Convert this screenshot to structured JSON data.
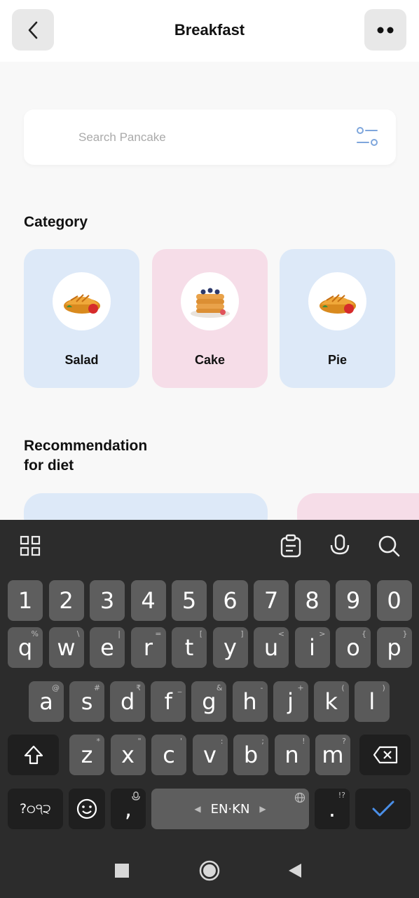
{
  "header": {
    "title": "Breakfast",
    "back_icon": "chevron-left-icon",
    "more_icon": "more-dots-icon"
  },
  "search": {
    "placeholder": "Search Pancake",
    "value": "",
    "filter_icon": "filter-icon"
  },
  "category": {
    "title": "Category",
    "items": [
      {
        "label": "Salad",
        "icon": "pie-icon",
        "color": "#dde9f8"
      },
      {
        "label": "Cake",
        "icon": "pancake-icon",
        "color": "#f6dde8"
      },
      {
        "label": "Pie",
        "icon": "pie-icon",
        "color": "#dde9f8"
      }
    ]
  },
  "recommendation": {
    "title_line1": "Recommendation",
    "title_line2": "for diet"
  },
  "keyboard": {
    "numbers": [
      "1",
      "2",
      "3",
      "4",
      "5",
      "6",
      "7",
      "8",
      "9",
      "0"
    ],
    "row1": [
      [
        "q",
        "%"
      ],
      [
        "w",
        "\\"
      ],
      [
        "e",
        "|"
      ],
      [
        "r",
        "="
      ],
      [
        "t",
        "["
      ],
      [
        "y",
        "]"
      ],
      [
        "u",
        "<"
      ],
      [
        "i",
        ">"
      ],
      [
        "o",
        "{"
      ],
      [
        "p",
        "}"
      ]
    ],
    "row2": [
      [
        "a",
        "@"
      ],
      [
        "s",
        "#"
      ],
      [
        "d",
        "₹"
      ],
      [
        "f",
        "_"
      ],
      [
        "g",
        "&"
      ],
      [
        "h",
        "-"
      ],
      [
        "j",
        "+"
      ],
      [
        "k",
        "("
      ],
      [
        "l",
        ")"
      ]
    ],
    "row3": [
      [
        "z",
        "*"
      ],
      [
        "x",
        "\""
      ],
      [
        "c",
        "'"
      ],
      [
        "v",
        ":"
      ],
      [
        "b",
        ";"
      ],
      [
        "n",
        "!"
      ],
      [
        "m",
        "?"
      ]
    ],
    "symbols_label": "?੦੧੨",
    "comma": ",",
    "space_label": "EN·KN",
    "period": ".",
    "period_sub": "!?"
  }
}
